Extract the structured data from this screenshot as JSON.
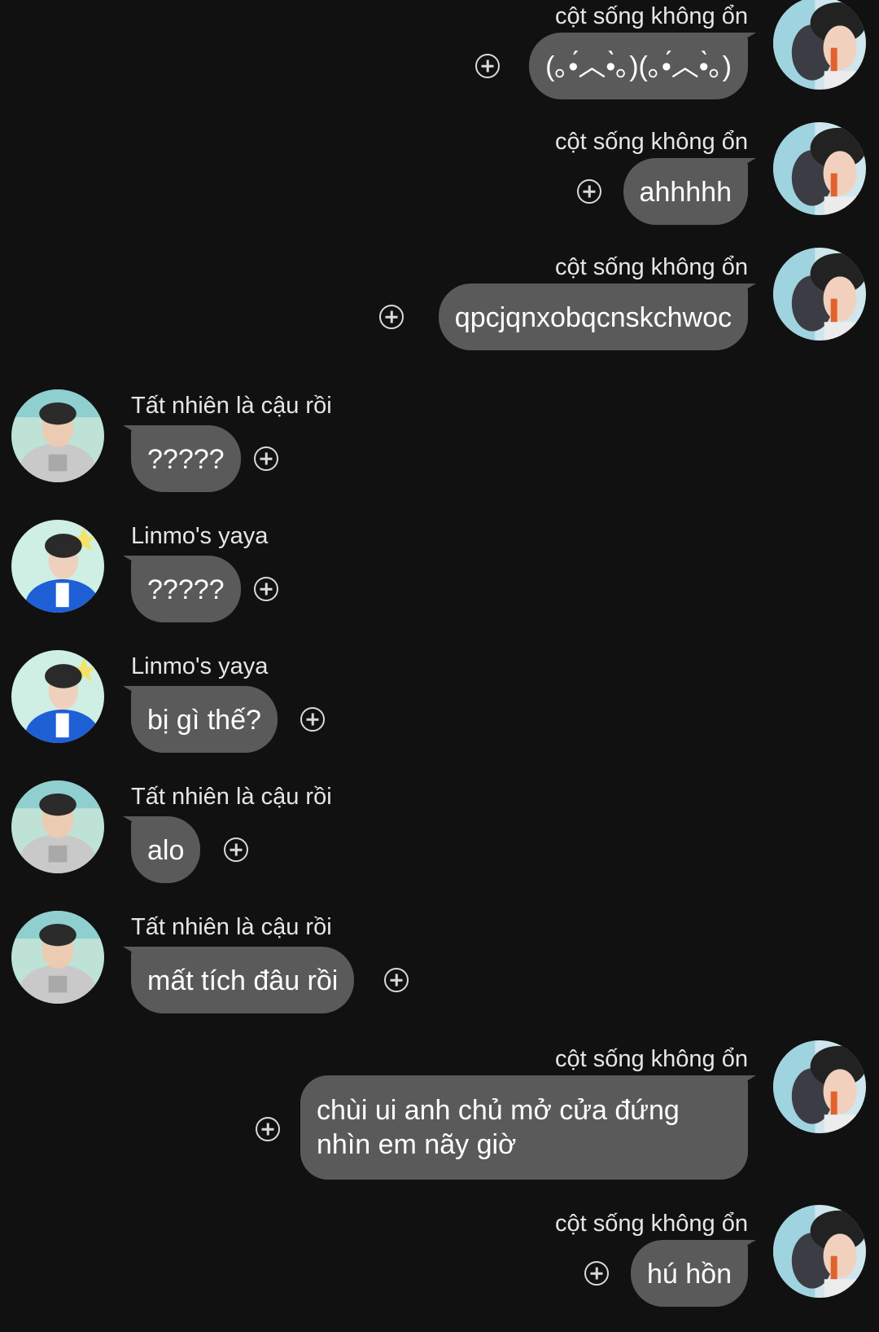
{
  "colors": {
    "background": "#111111",
    "bubble": "#5a5a5a",
    "name_text": "#e6e6e6",
    "icon": "#d9d9d9"
  },
  "messages": [
    {
      "side": "right",
      "sender": "cột sống không ổn",
      "text": "(｡•́︿•̀｡)(｡•́︿•̀｡)",
      "avatar": "avatar-juice"
    },
    {
      "side": "right",
      "sender": "cột sống không ổn",
      "text": "ahhhhh",
      "avatar": "avatar-juice"
    },
    {
      "side": "right",
      "sender": "cột sống không ổn",
      "text": "qpcjqnxobqcnskchwoc",
      "avatar": "avatar-juice"
    },
    {
      "side": "left",
      "sender": "Tất nhiên là cậu rồi",
      "text": "?????",
      "avatar": "avatar-hoodie"
    },
    {
      "side": "left",
      "sender": "Linmo's yaya",
      "text": "?????",
      "avatar": "avatar-blue-jacket"
    },
    {
      "side": "left",
      "sender": "Linmo's yaya",
      "text": "bị gì thế?",
      "avatar": "avatar-blue-jacket"
    },
    {
      "side": "left",
      "sender": "Tất nhiên là cậu rồi",
      "text": "alo",
      "avatar": "avatar-hoodie"
    },
    {
      "side": "left",
      "sender": "Tất nhiên là cậu rồi",
      "text": "mất tích đâu rồi",
      "avatar": "avatar-hoodie"
    },
    {
      "side": "right",
      "sender": "cột sống không ổn",
      "text": "chùi ui anh chủ mở cửa đứng nhìn em nãy giờ",
      "avatar": "avatar-juice"
    },
    {
      "side": "right",
      "sender": "cột sống không ổn",
      "text": "hú hồn",
      "avatar": "avatar-juice"
    }
  ]
}
